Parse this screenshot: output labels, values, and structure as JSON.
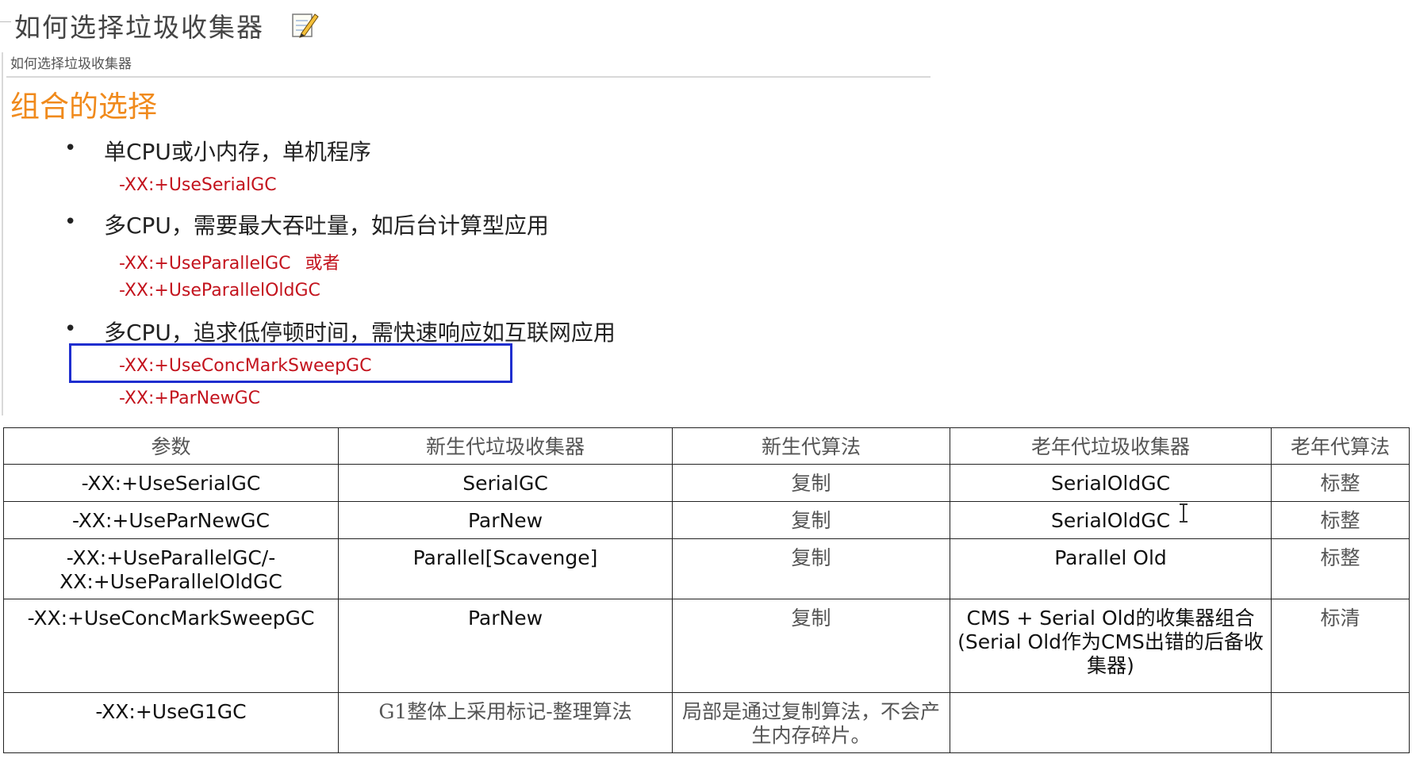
{
  "page": {
    "title": "如何选择垃圾收集器",
    "edit_icon": "edit-note-icon",
    "breadcrumb": "如何选择垃圾收集器"
  },
  "section": {
    "heading": "组合的选择",
    "bullets": [
      {
        "text": "单CPU或小内存，单机程序",
        "flags": [
          "-XX:+UseSerialGC"
        ]
      },
      {
        "text": "多CPU，需要最大吞吐量，如后台计算型应用",
        "flags": [
          "-XX:+UseParallelGC",
          "-XX:+UseParallelOldGC"
        ],
        "connector": "或者"
      },
      {
        "text": "多CPU，追求低停顿时间，需快速响应如互联网应用",
        "flags": [
          "-XX:+UseConcMarkSweepGC",
          "-XX:+ParNewGC"
        ]
      }
    ]
  },
  "table": {
    "headers": [
      "参数",
      "新生代垃圾收集器",
      "新生代算法",
      "老年代垃圾收集器",
      "老年代算法"
    ],
    "rows": [
      [
        "-XX:+UseSerialGC",
        "SerialGC",
        "复制",
        "SerialOldGC",
        "标整"
      ],
      [
        "-XX:+UseParNewGC",
        "ParNew",
        "复制",
        "SerialOldGC",
        "标整"
      ],
      [
        "-XX:+UseParallelGC/-XX:+UseParallelOldGC",
        "Parallel[Scavenge]",
        "复制",
        "Parallel Old",
        "标整"
      ],
      [
        "-XX:+UseConcMarkSweepGC",
        "ParNew",
        "复制",
        "CMS + Serial Old的收集器组合(Serial Old作为CMS出错的后备收集器)",
        "标清"
      ],
      [
        "-XX:+UseG1GC",
        "G1整体上采用标记-整理算法",
        "局部是通过复制算法，不会产生内存碎片。",
        "",
        ""
      ]
    ]
  },
  "colors": {
    "heading": "#f08a1c",
    "flag_text": "#c3131d",
    "highlight_border": "#1f2ecf"
  },
  "icons": {
    "cursor": "text-cursor-icon",
    "bullet": "bullet-dot-icon"
  }
}
